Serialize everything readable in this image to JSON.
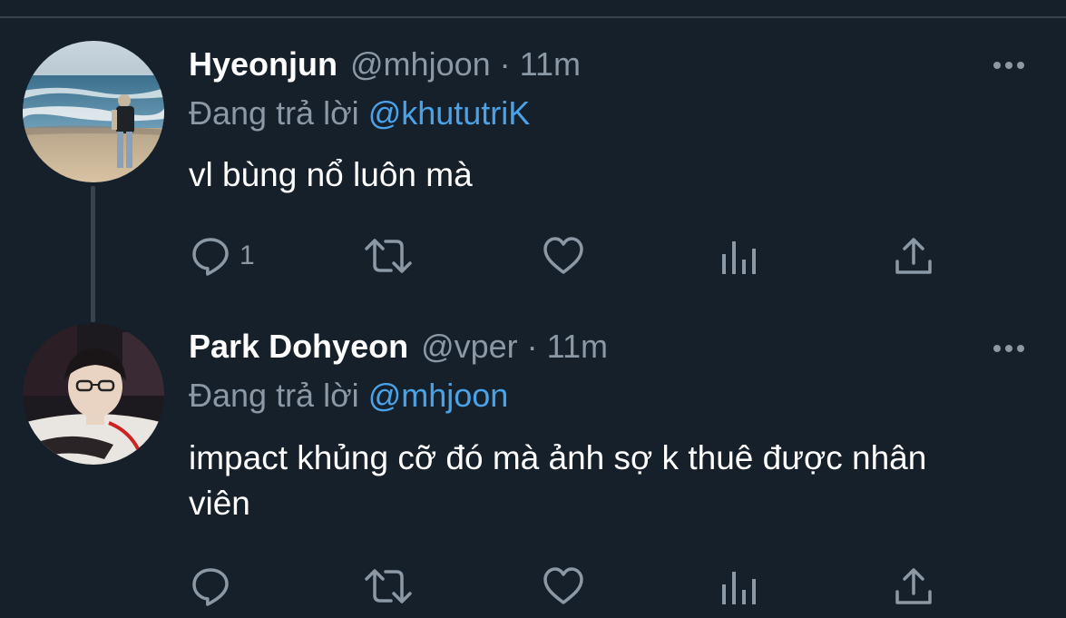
{
  "tweets": [
    {
      "name": "Hyeonjun",
      "handle": "@mhjoon",
      "separator": "·",
      "time": "11m",
      "replying_label": "Đang trả lời",
      "replying_to": "@khututriK",
      "text": "vl bùng nổ luôn mà",
      "reply_count": "1"
    },
    {
      "name": "Park Dohyeon",
      "handle": "@vper",
      "separator": "·",
      "time": "11m",
      "replying_label": "Đang trả lời",
      "replying_to": "@mhjoon",
      "text": "impact khủng cỡ đó mà ảnh sợ k thuê được nhân viên",
      "reply_count": ""
    }
  ],
  "icons": [
    "more-icon",
    "reply-icon",
    "retweet-icon",
    "like-icon",
    "analytics-icon",
    "share-icon"
  ],
  "colors": {
    "background": "#15202b",
    "secondary_text": "#8b98a5",
    "link": "#4aa3e8",
    "divider": "#38444d"
  }
}
